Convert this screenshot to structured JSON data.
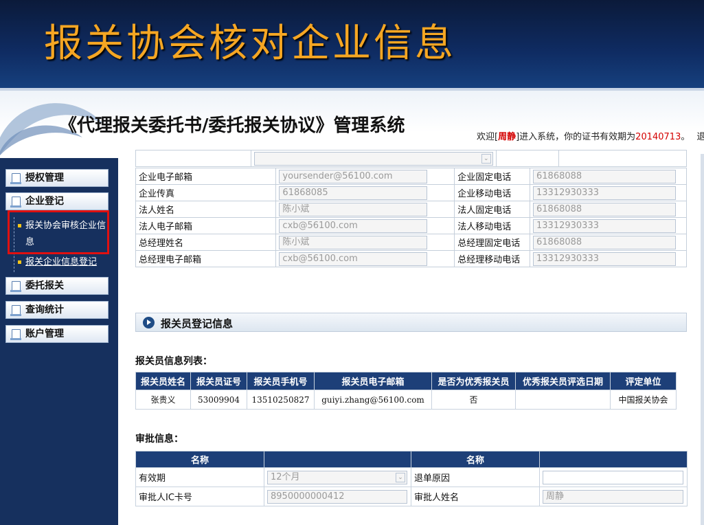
{
  "slide": {
    "title": "报关协会核对企业信息"
  },
  "header": {
    "system_title": "《代理报关委托书/委托报关协议》管理系统",
    "welcome_prefix": "欢迎[",
    "user_name": "周静",
    "welcome_mid": "]进入系统，你的证书有效期为",
    "cert_date": "20140713",
    "welcome_suffix": "。",
    "logout": "退出"
  },
  "sidebar": {
    "items": [
      {
        "label": "授权管理"
      },
      {
        "label": "企业登记"
      },
      {
        "label": "委托报关"
      },
      {
        "label": "查询统计"
      },
      {
        "label": "账户管理"
      }
    ],
    "sub_items": [
      {
        "label_line1": "报关协会审核企业信",
        "label_line2": "息"
      },
      {
        "label": "报关企业信息登记"
      }
    ]
  },
  "company_form": {
    "rows": [
      {
        "label1": "企业电子邮箱",
        "value1": "yoursender@56100.com",
        "label2": "企业固定电话",
        "value2": "61868088"
      },
      {
        "label1": "企业传真",
        "value1": "61868085",
        "label2": "企业移动电话",
        "value2": "13312930333"
      },
      {
        "label1": "法人姓名",
        "value1": "陈小斌",
        "label2": "法人固定电话",
        "value2": "61868088"
      },
      {
        "label1": "法人电子邮箱",
        "value1": "cxb@56100.com",
        "label2": "法人移动电话",
        "value2": "13312930333"
      },
      {
        "label1": "总经理姓名",
        "value1": "陈小斌",
        "label2": "总经理固定电话",
        "value2": "61868088"
      },
      {
        "label1": "总经理电子邮箱",
        "value1": "cxb@56100.com",
        "label2": "总经理移动电话",
        "value2": "13312930333"
      }
    ]
  },
  "section": {
    "title": "报关员登记信息"
  },
  "declarant_list": {
    "heading": "报关员信息列表：",
    "columns": [
      "报关员姓名",
      "报关员证号",
      "报关员手机号",
      "报关员电子邮箱",
      "是否为优秀报关员",
      "优秀报关员评选日期",
      "评定单位"
    ],
    "rows": [
      [
        "张贵义",
        "53009904",
        "13510250827",
        "guiyi.zhang@56100.com",
        "否",
        "",
        "中国报关协会"
      ]
    ]
  },
  "approval": {
    "heading": "审批信息：",
    "col_name1": "名称",
    "col_name2": "名称",
    "validity_label": "有效期",
    "validity_value": "12个月",
    "return_reason_label": "退单原因",
    "return_reason_value": "",
    "card_label": "审批人IC卡号",
    "card_value": "8950000000412",
    "approver_label": "审批人姓名",
    "approver_value": "周静"
  }
}
